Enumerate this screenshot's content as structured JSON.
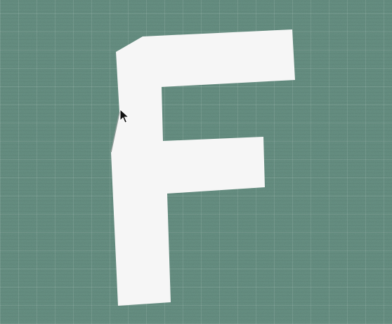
{
  "board": {
    "background_color": "#5f887b",
    "grid_color": "#7fa396"
  },
  "shape": {
    "name": "letter-f-shape",
    "fill_color": "#f6f6f6"
  },
  "cursor": {
    "icon": "arrow-cursor-icon"
  }
}
